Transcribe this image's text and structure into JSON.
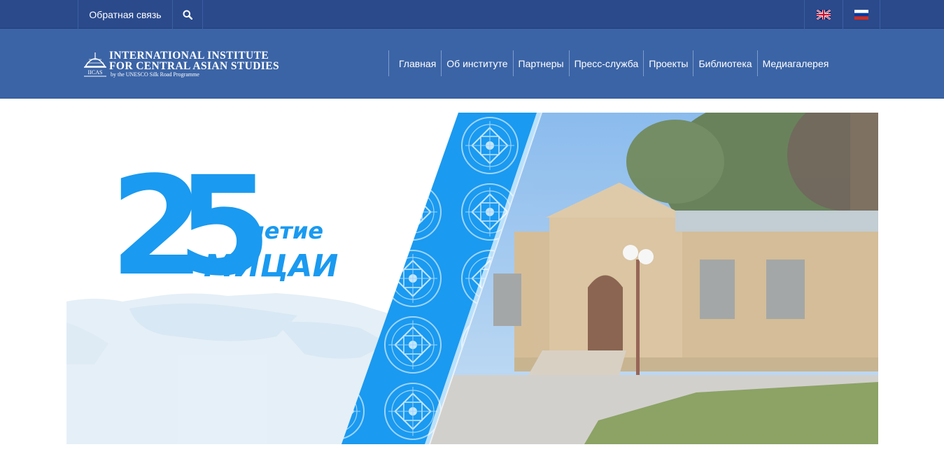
{
  "topbar": {
    "feedback_label": "Обратная связь",
    "search_icon": "search-icon",
    "languages": [
      {
        "code": "en",
        "icon": "uk-flag-icon"
      },
      {
        "code": "ru",
        "icon": "russia-flag-icon"
      }
    ]
  },
  "header": {
    "logo": {
      "abbr": "IICAS",
      "line1": "INTERNATIONAL INSTITUTE",
      "line2": "FOR CENTRAL ASIAN STUDIES",
      "line3": "by the UNESCO Silk Road Programme"
    },
    "nav": [
      {
        "label": "Главная"
      },
      {
        "label": "Об институте"
      },
      {
        "label": "Партнеры"
      },
      {
        "label": "Пресс-служба"
      },
      {
        "label": "Проекты"
      },
      {
        "label": "Библиотека"
      },
      {
        "label": "Медиагалерея"
      }
    ]
  },
  "banner": {
    "number": "25",
    "suffix": "-летие",
    "title": "МИЦАИ"
  },
  "colors": {
    "topbar": "#2a4a8c",
    "header": "#3b64a6",
    "accent_blue": "#1a9af0"
  }
}
